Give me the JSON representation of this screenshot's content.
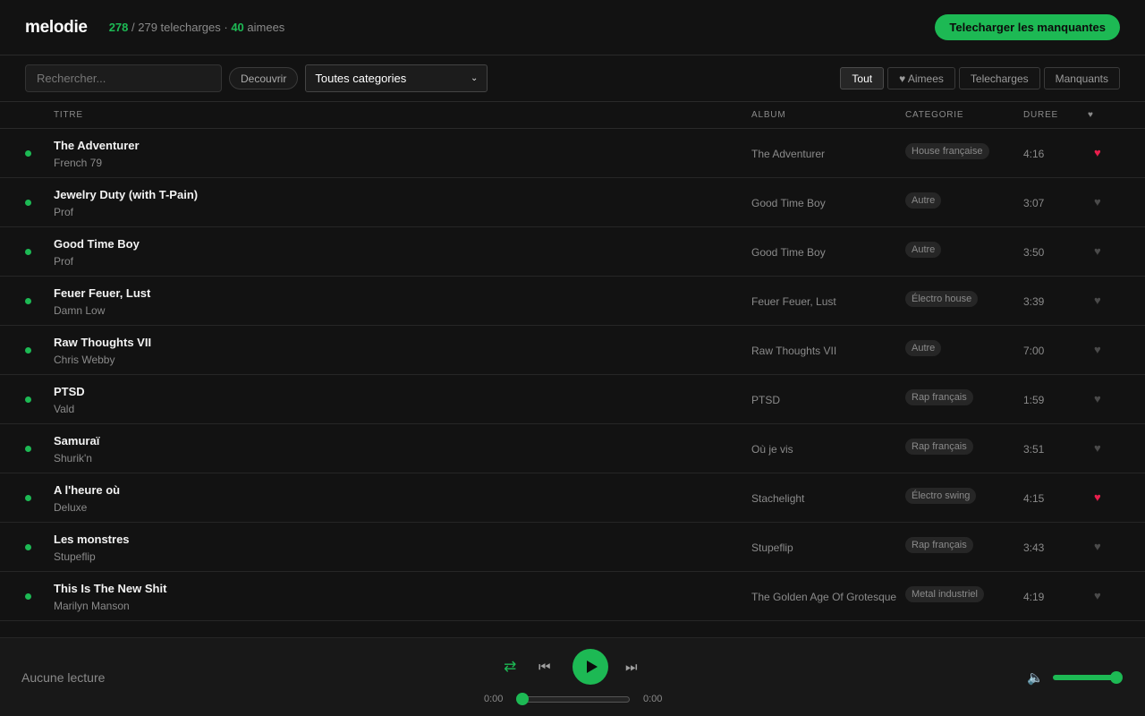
{
  "header": {
    "logo": "melodie",
    "stats": {
      "downloaded": "278",
      "sep1": " / 279 telecharges · ",
      "liked": "40",
      "liked_label": " aimees"
    },
    "download_missing_label": "Telecharger les manquantes"
  },
  "toolbar": {
    "search_placeholder": "Rechercher...",
    "discover_label": "Decouvrir",
    "category_selected": "Toutes categories",
    "filters": {
      "all": "Tout",
      "liked": "♥ Aimees",
      "downloaded": "Telecharges",
      "missing": "Manquants"
    }
  },
  "table": {
    "headers": {
      "title": "TITRE",
      "album": "ALBUM",
      "category": "CATEGORIE",
      "duration": "DUREE",
      "liked": "♥"
    },
    "rows": [
      {
        "title": "The Adventurer",
        "artist": "French 79",
        "album": "The Adventurer",
        "category": "House française",
        "duration": "4:16",
        "heart": "♥"
      },
      {
        "title": "Jewelry Duty (with T-Pain)",
        "artist": "Prof",
        "album": "Good Time Boy",
        "category": "Autre",
        "duration": "3:07",
        "heart": "♥"
      },
      {
        "title": "Good Time Boy",
        "artist": "Prof",
        "album": "Good Time Boy",
        "category": "Autre",
        "duration": "3:50",
        "heart": "♥"
      },
      {
        "title": "Feuer Feuer, Lust",
        "artist": "Damn Low",
        "album": "Feuer Feuer, Lust",
        "category": "Électro house",
        "duration": "3:39",
        "heart": "♥"
      },
      {
        "title": "Raw Thoughts VII",
        "artist": "Chris Webby",
        "album": "Raw Thoughts VII",
        "category": "Autre",
        "duration": "7:00",
        "heart": "♥"
      },
      {
        "title": "PTSD",
        "artist": "Vald",
        "album": "PTSD",
        "category": "Rap français",
        "duration": "1:59",
        "heart": "♥"
      },
      {
        "title": "Samuraï",
        "artist": "Shurik'n",
        "album": "Où je vis",
        "category": "Rap français",
        "duration": "3:51",
        "heart": "♥"
      },
      {
        "title": "A l'heure où",
        "artist": "Deluxe",
        "album": "Stachelight",
        "category": "Électro swing",
        "duration": "4:15",
        "heart": "♥"
      },
      {
        "title": "Les monstres",
        "artist": "Stupeflip",
        "album": "Stupeflip",
        "category": "Rap français",
        "duration": "3:43",
        "heart": "♥"
      },
      {
        "title": "This Is The New Shit",
        "artist": "Marilyn Manson",
        "album": "The Golden Age Of Grotesque",
        "category": "Metal industriel",
        "duration": "4:19",
        "heart": "♥"
      }
    ],
    "liked_rows": [
      0,
      7
    ]
  },
  "player": {
    "now_playing": "Aucune lecture",
    "time_current": "0:00",
    "time_total": "0:00",
    "progress_fraction": 0.0,
    "volume_fraction": 1.0,
    "icons": {
      "shuffle": "⇄",
      "prev": "⏮",
      "next": "⏭",
      "volume": "🔈"
    }
  },
  "colors": {
    "accent": "#1db954",
    "liked": "#e91e4c",
    "background": "#121212"
  }
}
